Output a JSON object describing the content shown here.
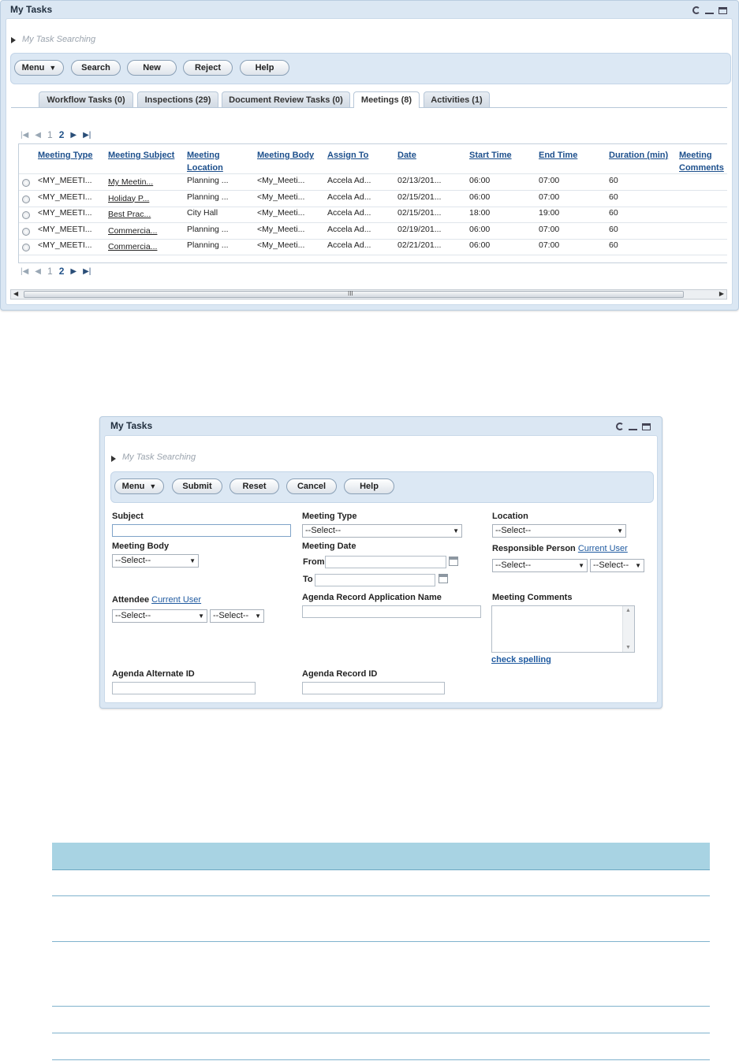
{
  "panel1": {
    "title": "My Tasks",
    "breadcrumb": "My Task Searching",
    "toolbar": {
      "menu": "Menu",
      "search": "Search",
      "new": "New",
      "reject": "Reject",
      "help": "Help"
    },
    "tabs": [
      {
        "label": "Workflow Tasks (0)"
      },
      {
        "label": "Inspections (29)"
      },
      {
        "label": "Document Review Tasks (0)"
      },
      {
        "label": "Meetings (8)"
      },
      {
        "label": "Activities (1)"
      }
    ],
    "pager": {
      "page1": "1",
      "page2": "2"
    },
    "columns": [
      "Meeting Type",
      "Meeting Subject",
      "Meeting Location",
      "Meeting Body",
      "Assign To",
      "Date",
      "Start Time",
      "End Time",
      "Duration (min)",
      "Meeting Comments"
    ],
    "rows": [
      [
        "<MY_MEETI...",
        "My Meetin...",
        "Planning ...",
        "<My_Meeti...",
        "Accela Ad...",
        "02/13/201...",
        "06:00",
        "07:00",
        "60",
        ""
      ],
      [
        "<MY_MEETI...",
        "Holiday P...",
        "Planning ...",
        "<My_Meeti...",
        "Accela Ad...",
        "02/15/201...",
        "06:00",
        "07:00",
        "60",
        ""
      ],
      [
        "<MY_MEETI...",
        "Best Prac...",
        "City Hall",
        "<My_Meeti...",
        "Accela Ad...",
        "02/15/201...",
        "18:00",
        "19:00",
        "60",
        ""
      ],
      [
        "<MY_MEETI...",
        "Commercia...",
        "Planning ...",
        "<My_Meeti...",
        "Accela Ad...",
        "02/19/201...",
        "06:00",
        "07:00",
        "60",
        ""
      ],
      [
        "<MY_MEETI...",
        "Commercia...",
        "Planning ...",
        "<My_Meeti...",
        "Accela Ad...",
        "02/21/201...",
        "06:00",
        "07:00",
        "60",
        ""
      ]
    ],
    "scroll_grip": "III"
  },
  "panel2": {
    "title": "My Tasks",
    "breadcrumb": "My Task Searching",
    "toolbar": {
      "menu": "Menu",
      "submit": "Submit",
      "reset": "Reset",
      "cancel": "Cancel",
      "help": "Help"
    },
    "labels": {
      "subject": "Subject",
      "meeting_type": "Meeting Type",
      "location": "Location",
      "meeting_body": "Meeting Body",
      "meeting_date": "Meeting Date",
      "responsible_person": "Responsible Person",
      "current_user": "Current User",
      "from": "From",
      "to": "To",
      "attendee": "Attendee",
      "agenda_record_app_name": "Agenda Record Application Name",
      "meeting_comments": "Meeting Comments",
      "check_spelling": "check spelling",
      "agenda_alternate_id": "Agenda Alternate ID",
      "agenda_record_id": "Agenda Record ID"
    },
    "select_default": "--Select--"
  }
}
